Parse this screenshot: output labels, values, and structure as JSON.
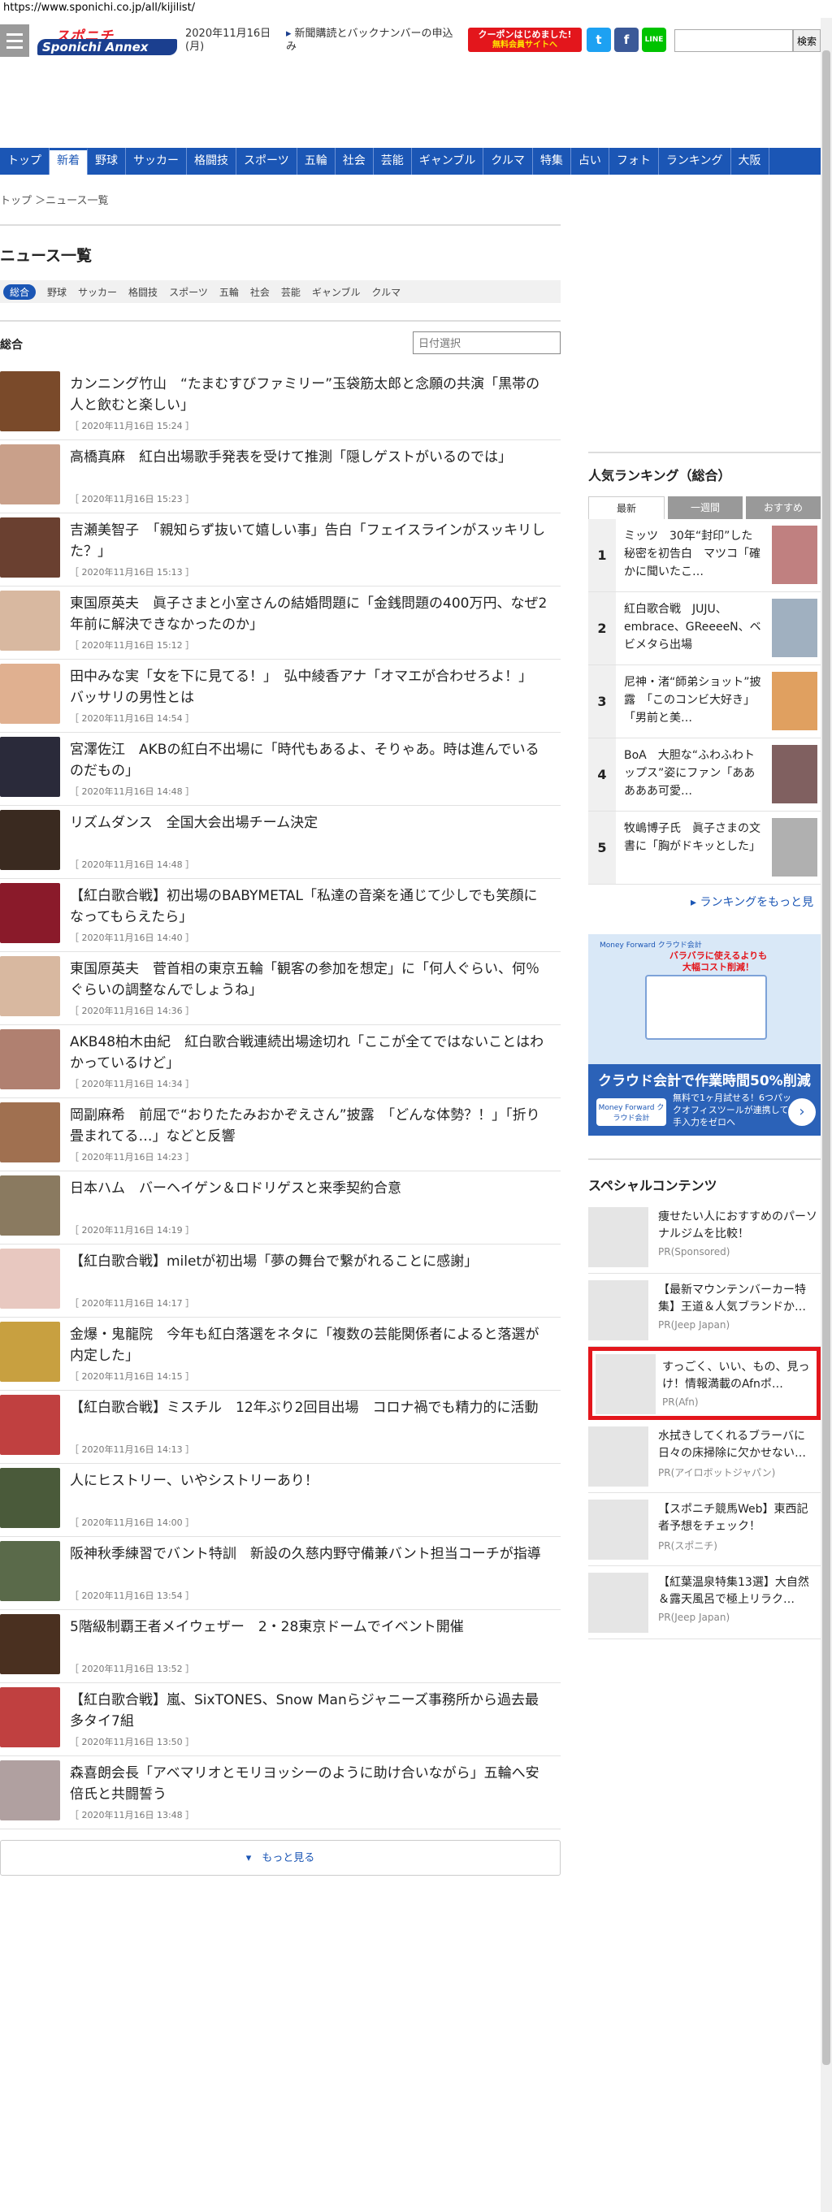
{
  "url": "https://www.sponichi.co.jp/all/kijilist/",
  "header": {
    "logo_top": "スポニチ",
    "logo_main": "Sponichi Annex",
    "date": "2020年11月16日(月)",
    "subscribe": "新聞購読とバックナンバーの申込み",
    "coupon_line1": "クーポンはじめました!",
    "coupon_line2": "無料会員サイトへ",
    "search_button": "検索",
    "twitter": "t",
    "facebook": "f",
    "line": "LINE"
  },
  "nav": [
    "トップ",
    "新着",
    "野球",
    "サッカー",
    "格闘技",
    "スポーツ",
    "五輪",
    "社会",
    "芸能",
    "ギャンブル",
    "クルマ",
    "特集",
    "占い",
    "フォト",
    "ランキング",
    "大阪"
  ],
  "breadcrumb": "トップ ＞ニュース一覧",
  "page_title": "ニュース一覧",
  "categories": [
    "総合",
    "野球",
    "サッカー",
    "格闘技",
    "スポーツ",
    "五輪",
    "社会",
    "芸能",
    "ギャンブル",
    "クルマ"
  ],
  "section_label": "総合",
  "date_select_placeholder": "日付選択",
  "news": [
    {
      "title": "カンニング竹山　“たまむすびファミリー”玉袋筋太郎と念願の共演「黒帯の人と飲むと楽しい」",
      "time": "［ 2020年11月16日 15:24 ］",
      "color": "#7a4a2a"
    },
    {
      "title": "高橋真麻　紅白出場歌手発表を受けて推測「隠しゲストがいるのでは」",
      "time": "［ 2020年11月16日 15:23 ］",
      "color": "#c9a08a"
    },
    {
      "title": "吉瀬美智子　「親知らず抜いて嬉しい事」告白「フェイスラインがスッキリした？」",
      "time": "［ 2020年11月16日 15:13 ］",
      "color": "#6a4030"
    },
    {
      "title": "東国原英夫　眞子さまと小室さんの結婚問題に「金銭問題の400万円、なぜ2年前に解決できなかったのか」",
      "time": "［ 2020年11月16日 15:12 ］",
      "color": "#d8b8a0"
    },
    {
      "title": "田中みな実「女を下に見てる！」　弘中綾香アナ「オマエが合わせろよ！」　バッサリの男性とは",
      "time": "［ 2020年11月16日 14:54 ］",
      "color": "#e0b090"
    },
    {
      "title": "宮澤佐江　AKBの紅白不出場に「時代もあるよ、そりゃあ。時は進んでいるのだもの」",
      "time": "［ 2020年11月16日 14:48 ］",
      "color": "#2a2a3a"
    },
    {
      "title": "リズムダンス　全国大会出場チーム決定",
      "time": "［ 2020年11月16日 14:48 ］",
      "color": "#3a2a20"
    },
    {
      "title": "【紅白歌合戦】初出場のBABYMETAL「私達の音楽を通じて少しでも笑顔になってもらえたら」",
      "time": "［ 2020年11月16日 14:40 ］",
      "color": "#8a1a2a"
    },
    {
      "title": "東国原英夫　菅首相の東京五輪「観客の参加を想定」に「何人ぐらい、何％ぐらいの調整なんでしょうね」",
      "time": "［ 2020年11月16日 14:36 ］",
      "color": "#d8b8a0"
    },
    {
      "title": "AKB48柏木由紀　紅白歌合戦連続出場途切れ「ここが全てではないことはわかっているけど」",
      "time": "［ 2020年11月16日 14:34 ］",
      "color": "#b08070"
    },
    {
      "title": "岡副麻希　前屈で“おりたたみおかぞえさん”披露　「どんな体勢？！」「折り畳まれてる…」などと反響",
      "time": "［ 2020年11月16日 14:23 ］",
      "color": "#a07050"
    },
    {
      "title": "日本ハム　バーヘイゲン＆ロドリゲスと来季契約合意",
      "time": "［ 2020年11月16日 14:19 ］",
      "color": "#8a7a60"
    },
    {
      "title": "【紅白歌合戦】miletが初出場「夢の舞台で繋がれることに感謝」",
      "time": "［ 2020年11月16日 14:17 ］",
      "color": "#e8c8c0"
    },
    {
      "title": "金爆・鬼龍院　今年も紅白落選をネタに「複数の芸能関係者によると落選が内定した」",
      "time": "［ 2020年11月16日 14:15 ］",
      "color": "#c8a040"
    },
    {
      "title": "【紅白歌合戦】ミスチル　12年ぶり2回目出場　コロナ禍でも精力的に活動",
      "time": "［ 2020年11月16日 14:13 ］",
      "color": "#c04040"
    },
    {
      "title": "人にヒストリー、いやシストリーあり！",
      "time": "［ 2020年11月16日 14:00 ］",
      "color": "#4a5a3a"
    },
    {
      "title": "阪神秋季練習でバント特訓　新設の久慈内野守備兼バント担当コーチが指導",
      "time": "［ 2020年11月16日 13:54 ］",
      "color": "#5a6a4a"
    },
    {
      "title": "5階級制覇王者メイウェザー　2・28東京ドームでイベント開催",
      "time": "［ 2020年11月16日 13:52 ］",
      "color": "#4a3020"
    },
    {
      "title": "【紅白歌合戦】嵐、SixTONES、Snow Manらジャニーズ事務所から過去最多タイ7組",
      "time": "［ 2020年11月16日 13:50 ］",
      "color": "#c04040"
    },
    {
      "title": "森喜朗会長「アベマリオとモリヨッシーのように助け合いながら」五輪へ安倍氏と共闘誓う",
      "time": "［ 2020年11月16日 13:48 ］",
      "color": "#b0a0a0"
    }
  ],
  "more_button": "もっと見る",
  "ranking": {
    "title": "人気ランキング（総合）",
    "tabs": [
      "最新",
      "一週間",
      "おすすめ"
    ],
    "items": [
      {
        "num": "1",
        "text": "ミッツ　30年“封印”した秘密を初告白　マツコ「確かに聞いたこ…",
        "color": "#c08080"
      },
      {
        "num": "2",
        "text": "紅白歌合戦　JUJU、embrace、GReeeeN、ベビメタら出場",
        "color": "#a0b0c0"
      },
      {
        "num": "3",
        "text": "尼神・渚“師弟ショット”披露　「このコンビ大好き」「男前と美…",
        "color": "#e0a060"
      },
      {
        "num": "4",
        "text": "BoA　大胆な“ふわふわトップス”姿にファン「あああああ可愛…",
        "color": "#806060"
      },
      {
        "num": "5",
        "text": "牧嶋博子氏　眞子さまの文書に「胸がドキッとした」",
        "color": "#b0b0b0"
      }
    ],
    "more": "ランキングをもっと見"
  },
  "ad": {
    "brand": "Money Forward クラウド会計",
    "head_line1": "バラバラに使えるよりも",
    "head_line2": "大幅コスト削減！",
    "title": "クラウド会計で作業時間50%削減",
    "desc": "無料で1ヶ月試せる！6つパックオフィスツールが連携して手入力をゼロへ",
    "logo": "Money Forward クラウド会計",
    "cta": "›"
  },
  "special": {
    "title": "スペシャルコンテンツ",
    "items": [
      {
        "text": "痩せたい人におすすめのパーソナルジムを比較！",
        "pr": "PR(Sponsored)"
      },
      {
        "text": "【最新マウンテンバーカー特集】王道＆人気ブランドか…",
        "pr": "PR(Jeep Japan)"
      },
      {
        "text": "すっごく、いい、もの、見っけ！情報満載のAfnポ…",
        "pr": "PR(Afn)"
      },
      {
        "text": "水拭きしてくれるブラーバに日々の床掃除に欠かせない…",
        "pr": "PR(アイロボットジャパン)"
      },
      {
        "text": "【スポニチ競馬Web】東西記者予想をチェック！",
        "pr": "PR(スポニチ)"
      },
      {
        "text": "【紅葉温泉特集13選】大自然＆露天風呂で極上リラク…",
        "pr": "PR(Jeep Japan)"
      }
    ]
  }
}
